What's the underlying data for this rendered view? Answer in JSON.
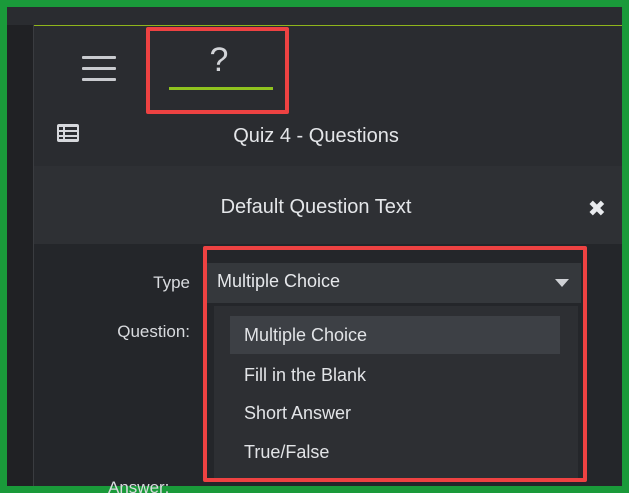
{
  "toolbar": {
    "menu_icon": "hamburger-menu-icon",
    "help_tab_glyph": "?"
  },
  "quiz": {
    "icon": "list-icon",
    "title": "Quiz 4 - Questions"
  },
  "question": {
    "title": "Default Question Text",
    "close_glyph": "✖"
  },
  "form": {
    "type_label": "Type",
    "question_label": "Question:",
    "answer_label": "Answer:",
    "type_value": "Multiple Choice",
    "type_options": [
      "Multiple Choice",
      "Fill in the Blank",
      "Short Answer",
      "True/False"
    ],
    "selected_option_index": 0
  },
  "colors": {
    "frame_border": "#1a9a3a",
    "highlight_box": "#ee4242",
    "tab_underline": "#8fc31f",
    "panel_bg": "#27292d"
  }
}
